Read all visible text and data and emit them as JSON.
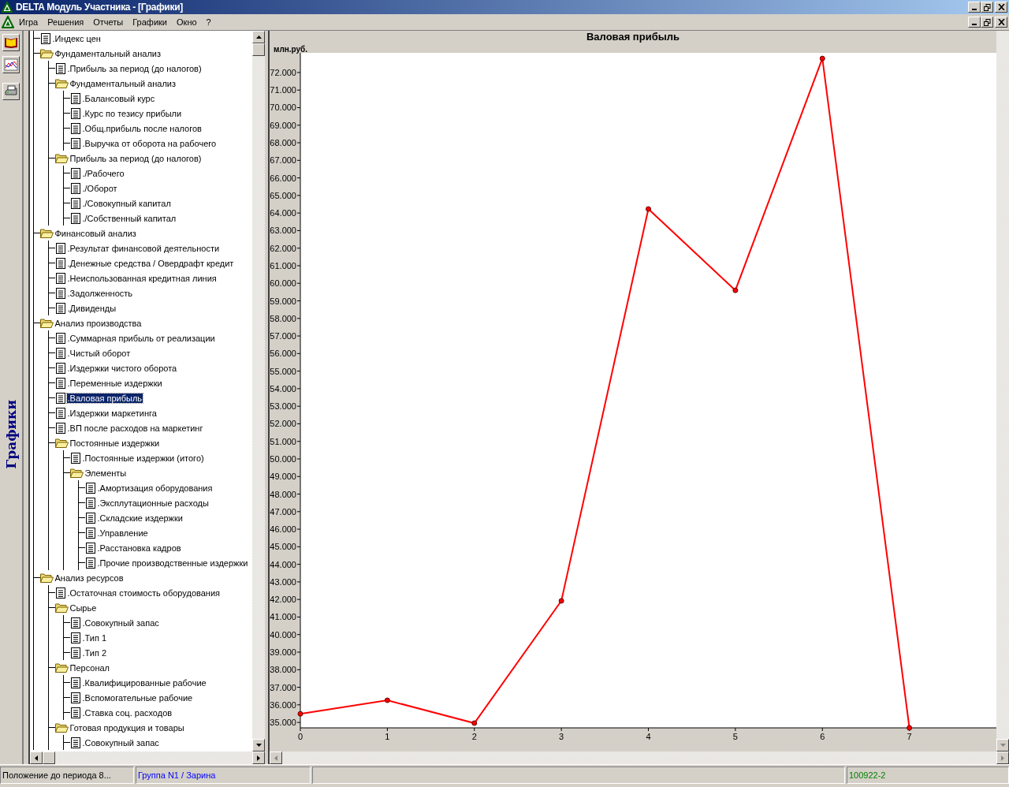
{
  "window": {
    "title": "DELTA Модуль Участника - [Графики]"
  },
  "menu": [
    "Игра",
    "Решения",
    "Отчеты",
    "Графики",
    "Окно",
    "?"
  ],
  "side_label": "Графики",
  "tree": [
    {
      "kind": "document",
      "label": ".Индекс цен",
      "selected": false
    },
    {
      "kind": "folder",
      "label": "Фундаментальный анализ",
      "selected": false,
      "children": [
        {
          "kind": "document",
          "label": ".Прибыль за период (до налогов)",
          "selected": false
        },
        {
          "kind": "folder",
          "label": "Фундаментальный анализ",
          "selected": false,
          "children": [
            {
              "kind": "document",
              "label": ".Балансовый курс",
              "selected": false
            },
            {
              "kind": "document",
              "label": ".Курс по тезису прибыли",
              "selected": false
            },
            {
              "kind": "document",
              "label": ".Общ.прибыль после налогов",
              "selected": false
            },
            {
              "kind": "document",
              "label": ".Выручка от оборота на рабочего",
              "selected": false
            }
          ]
        },
        {
          "kind": "folder",
          "label": "Прибыль за период (до налогов)",
          "selected": false,
          "children": [
            {
              "kind": "document",
              "label": "./Рабочего",
              "selected": false
            },
            {
              "kind": "document",
              "label": "./Оборот",
              "selected": false
            },
            {
              "kind": "document",
              "label": "./Совокупный капитал",
              "selected": false
            },
            {
              "kind": "document",
              "label": "./Собственный капитал",
              "selected": false
            }
          ]
        }
      ]
    },
    {
      "kind": "folder",
      "label": "Финансовый анализ",
      "selected": false,
      "children": [
        {
          "kind": "document",
          "label": ".Результат финансовой деятельности",
          "selected": false
        },
        {
          "kind": "document",
          "label": ".Денежные средства / Овердрафт кредит",
          "selected": false
        },
        {
          "kind": "document",
          "label": ".Неиспользованная кредитная линия",
          "selected": false
        },
        {
          "kind": "document",
          "label": ".Задолженность",
          "selected": false
        },
        {
          "kind": "document",
          "label": ".Дивиденды",
          "selected": false
        }
      ]
    },
    {
      "kind": "folder",
      "label": "Анализ производства",
      "selected": false,
      "children": [
        {
          "kind": "document",
          "label": ".Суммарная прибыль от реализации",
          "selected": false
        },
        {
          "kind": "document",
          "label": ".Чистый оборот",
          "selected": false
        },
        {
          "kind": "document",
          "label": ".Издержки чистого оборота",
          "selected": false
        },
        {
          "kind": "document",
          "label": ".Переменные издержки",
          "selected": false
        },
        {
          "kind": "document",
          "label": ".Валовая прибыль",
          "selected": true
        },
        {
          "kind": "document",
          "label": ".Издержки маркетинга",
          "selected": false
        },
        {
          "kind": "document",
          "label": ".ВП после расходов на маркетинг",
          "selected": false
        },
        {
          "kind": "folder",
          "label": "Постоянные издержки",
          "selected": false,
          "children": [
            {
              "kind": "document",
              "label": ".Постоянные издержки (итого)",
              "selected": false
            },
            {
              "kind": "folder",
              "label": "Элементы",
              "selected": false,
              "children": [
                {
                  "kind": "document",
                  "label": ".Амортизация оборудования",
                  "selected": false
                },
                {
                  "kind": "document",
                  "label": ".Эксплутационные расходы",
                  "selected": false
                },
                {
                  "kind": "document",
                  "label": ".Складские издержки",
                  "selected": false
                },
                {
                  "kind": "document",
                  "label": ".Управление",
                  "selected": false
                },
                {
                  "kind": "document",
                  "label": ".Расстановка кадров",
                  "selected": false
                },
                {
                  "kind": "document",
                  "label": ".Прочие производственные издержки",
                  "selected": false
                }
              ]
            }
          ]
        }
      ]
    },
    {
      "kind": "folder",
      "label": "Анализ ресурсов",
      "selected": false,
      "children": [
        {
          "kind": "document",
          "label": ".Остаточная стоимость оборудования",
          "selected": false
        },
        {
          "kind": "folder",
          "label": "Сырье",
          "selected": false,
          "children": [
            {
              "kind": "document",
              "label": ".Совокупный запас",
              "selected": false
            },
            {
              "kind": "document",
              "label": ".Тип 1",
              "selected": false
            },
            {
              "kind": "document",
              "label": ".Тип 2",
              "selected": false
            }
          ]
        },
        {
          "kind": "folder",
          "label": "Персонал",
          "selected": false,
          "children": [
            {
              "kind": "document",
              "label": ".Квалифицированные рабочие",
              "selected": false
            },
            {
              "kind": "document",
              "label": ".Вспомогательные рабочие",
              "selected": false
            },
            {
              "kind": "document",
              "label": ".Ставка соц. расходов",
              "selected": false
            }
          ]
        },
        {
          "kind": "folder",
          "label": "Готовая продукция и товары",
          "selected": false,
          "children": [
            {
              "kind": "document",
              "label": ".Совокупный запас",
              "selected": false
            }
          ]
        }
      ]
    }
  ],
  "chart": {
    "chart_data": {
      "type": "line",
      "title": "Валовая прибыль",
      "ylabel": "млн.руб.",
      "x": [
        0,
        1,
        2,
        3,
        4,
        5,
        6,
        7
      ],
      "series": [
        {
          "color": "#ff0000",
          "marker": "circle",
          "values": [
            35490,
            36260,
            34960,
            41920,
            64230,
            59600,
            72800,
            34690
          ]
        }
      ],
      "xlim": [
        0,
        8
      ],
      "ylim": [
        34690,
        73120
      ],
      "xticks": [
        0,
        1,
        2,
        3,
        4,
        5,
        6,
        7
      ],
      "yticks": [
        {
          "value": 35000,
          "label": "35.000"
        },
        {
          "value": 36000,
          "label": "36.000"
        },
        {
          "value": 37000,
          "label": "37.000"
        },
        {
          "value": 38000,
          "label": "38.000"
        },
        {
          "value": 39000,
          "label": "39.000"
        },
        {
          "value": 40000,
          "label": "40.000"
        },
        {
          "value": 41000,
          "label": "41.000"
        },
        {
          "value": 42000,
          "label": "42.000"
        },
        {
          "value": 43000,
          "label": "43.000"
        },
        {
          "value": 44000,
          "label": "44.000"
        },
        {
          "value": 45000,
          "label": "45.000"
        },
        {
          "value": 46000,
          "label": "46.000"
        },
        {
          "value": 47000,
          "label": "47.000"
        },
        {
          "value": 48000,
          "label": "48.000"
        },
        {
          "value": 49000,
          "label": "49.000"
        },
        {
          "value": 50000,
          "label": "50.000"
        },
        {
          "value": 51000,
          "label": "51.000"
        },
        {
          "value": 52000,
          "label": "52.000"
        },
        {
          "value": 53000,
          "label": "53.000"
        },
        {
          "value": 54000,
          "label": "54.000"
        },
        {
          "value": 55000,
          "label": "55.000"
        },
        {
          "value": 56000,
          "label": "56.000"
        },
        {
          "value": 57000,
          "label": "57.000"
        },
        {
          "value": 58000,
          "label": "58.000"
        },
        {
          "value": 59000,
          "label": "59.000"
        },
        {
          "value": 60000,
          "label": "60.000"
        },
        {
          "value": 61000,
          "label": "61.000"
        },
        {
          "value": 62000,
          "label": "62.000"
        },
        {
          "value": 63000,
          "label": "63.000"
        },
        {
          "value": 64000,
          "label": "64.000"
        },
        {
          "value": 65000,
          "label": "65.000"
        },
        {
          "value": 66000,
          "label": "66.000"
        },
        {
          "value": 67000,
          "label": "67.000"
        },
        {
          "value": 68000,
          "label": "68.000"
        },
        {
          "value": 69000,
          "label": "69.000"
        },
        {
          "value": 70000,
          "label": "70.000"
        },
        {
          "value": 71000,
          "label": "71.000"
        },
        {
          "value": 72000,
          "label": "72.000"
        }
      ]
    }
  },
  "status_bar": {
    "position": "Положение до периода 8...",
    "group": "Группа N1 / Зарина",
    "code": "100922-2"
  }
}
